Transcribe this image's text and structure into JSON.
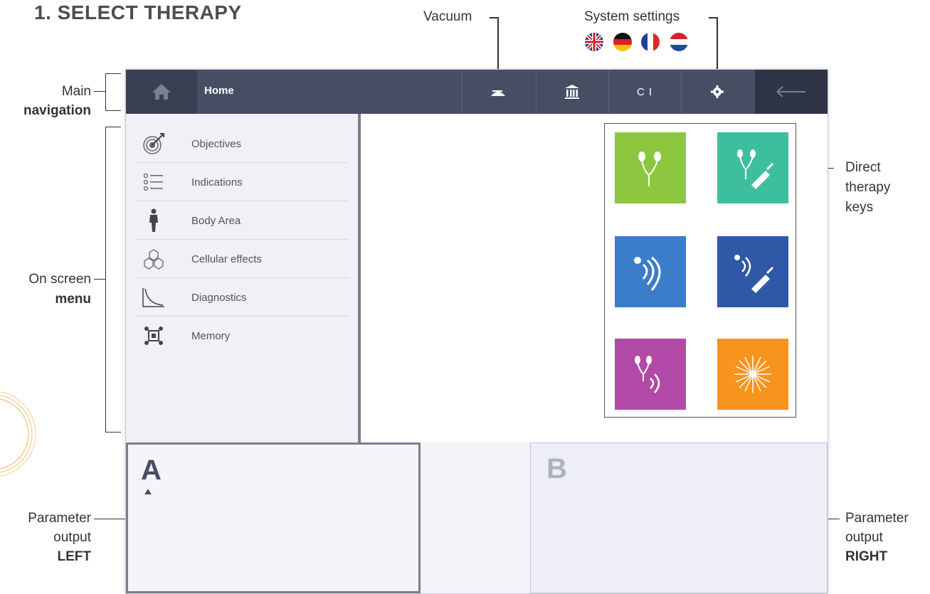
{
  "title": "1. SELECT THERAPY",
  "callouts": {
    "vacuum": "Vacuum",
    "system_settings": "System settings",
    "main_navigation_line1": "Main",
    "main_navigation_line2": "navigation",
    "on_screen_menu_line1": "On screen",
    "on_screen_menu_line2": "menu",
    "direct_keys_line1": "Direct",
    "direct_keys_line2": "therapy",
    "direct_keys_line3": "keys",
    "param_left_line1": "Parameter",
    "param_left_line2": "output",
    "param_left_line3": "LEFT",
    "param_right_line1": "Parameter",
    "param_right_line2": "output",
    "param_right_line3": "RIGHT"
  },
  "nav": {
    "home_label": "Home",
    "ci_label": "C I"
  },
  "menu": {
    "items": [
      {
        "label": "Objectives",
        "icon": "target-icon"
      },
      {
        "label": "Indications",
        "icon": "list-icon"
      },
      {
        "label": "Body Area",
        "icon": "body-icon"
      },
      {
        "label": "Cellular effects",
        "icon": "cells-icon"
      },
      {
        "label": "Diagnostics",
        "icon": "curve-icon"
      },
      {
        "label": "Memory",
        "icon": "memory-icon"
      }
    ]
  },
  "therapy_keys": [
    {
      "name": "electrotherapy",
      "color": "#8cc63f"
    },
    {
      "name": "electrotherapy-combination",
      "color": "#3dbf9e"
    },
    {
      "name": "ultrasound",
      "color": "#3a7dc9"
    },
    {
      "name": "ultrasound-combination",
      "color": "#2f58a6"
    },
    {
      "name": "electro-ultrasound-combination",
      "color": "#b14aa6"
    },
    {
      "name": "laser",
      "color": "#f7941d"
    }
  ],
  "panels": {
    "left_label": "A",
    "right_label": "B"
  },
  "flags": [
    "uk-flag",
    "germany-flag",
    "france-flag",
    "netherlands-flag"
  ]
}
